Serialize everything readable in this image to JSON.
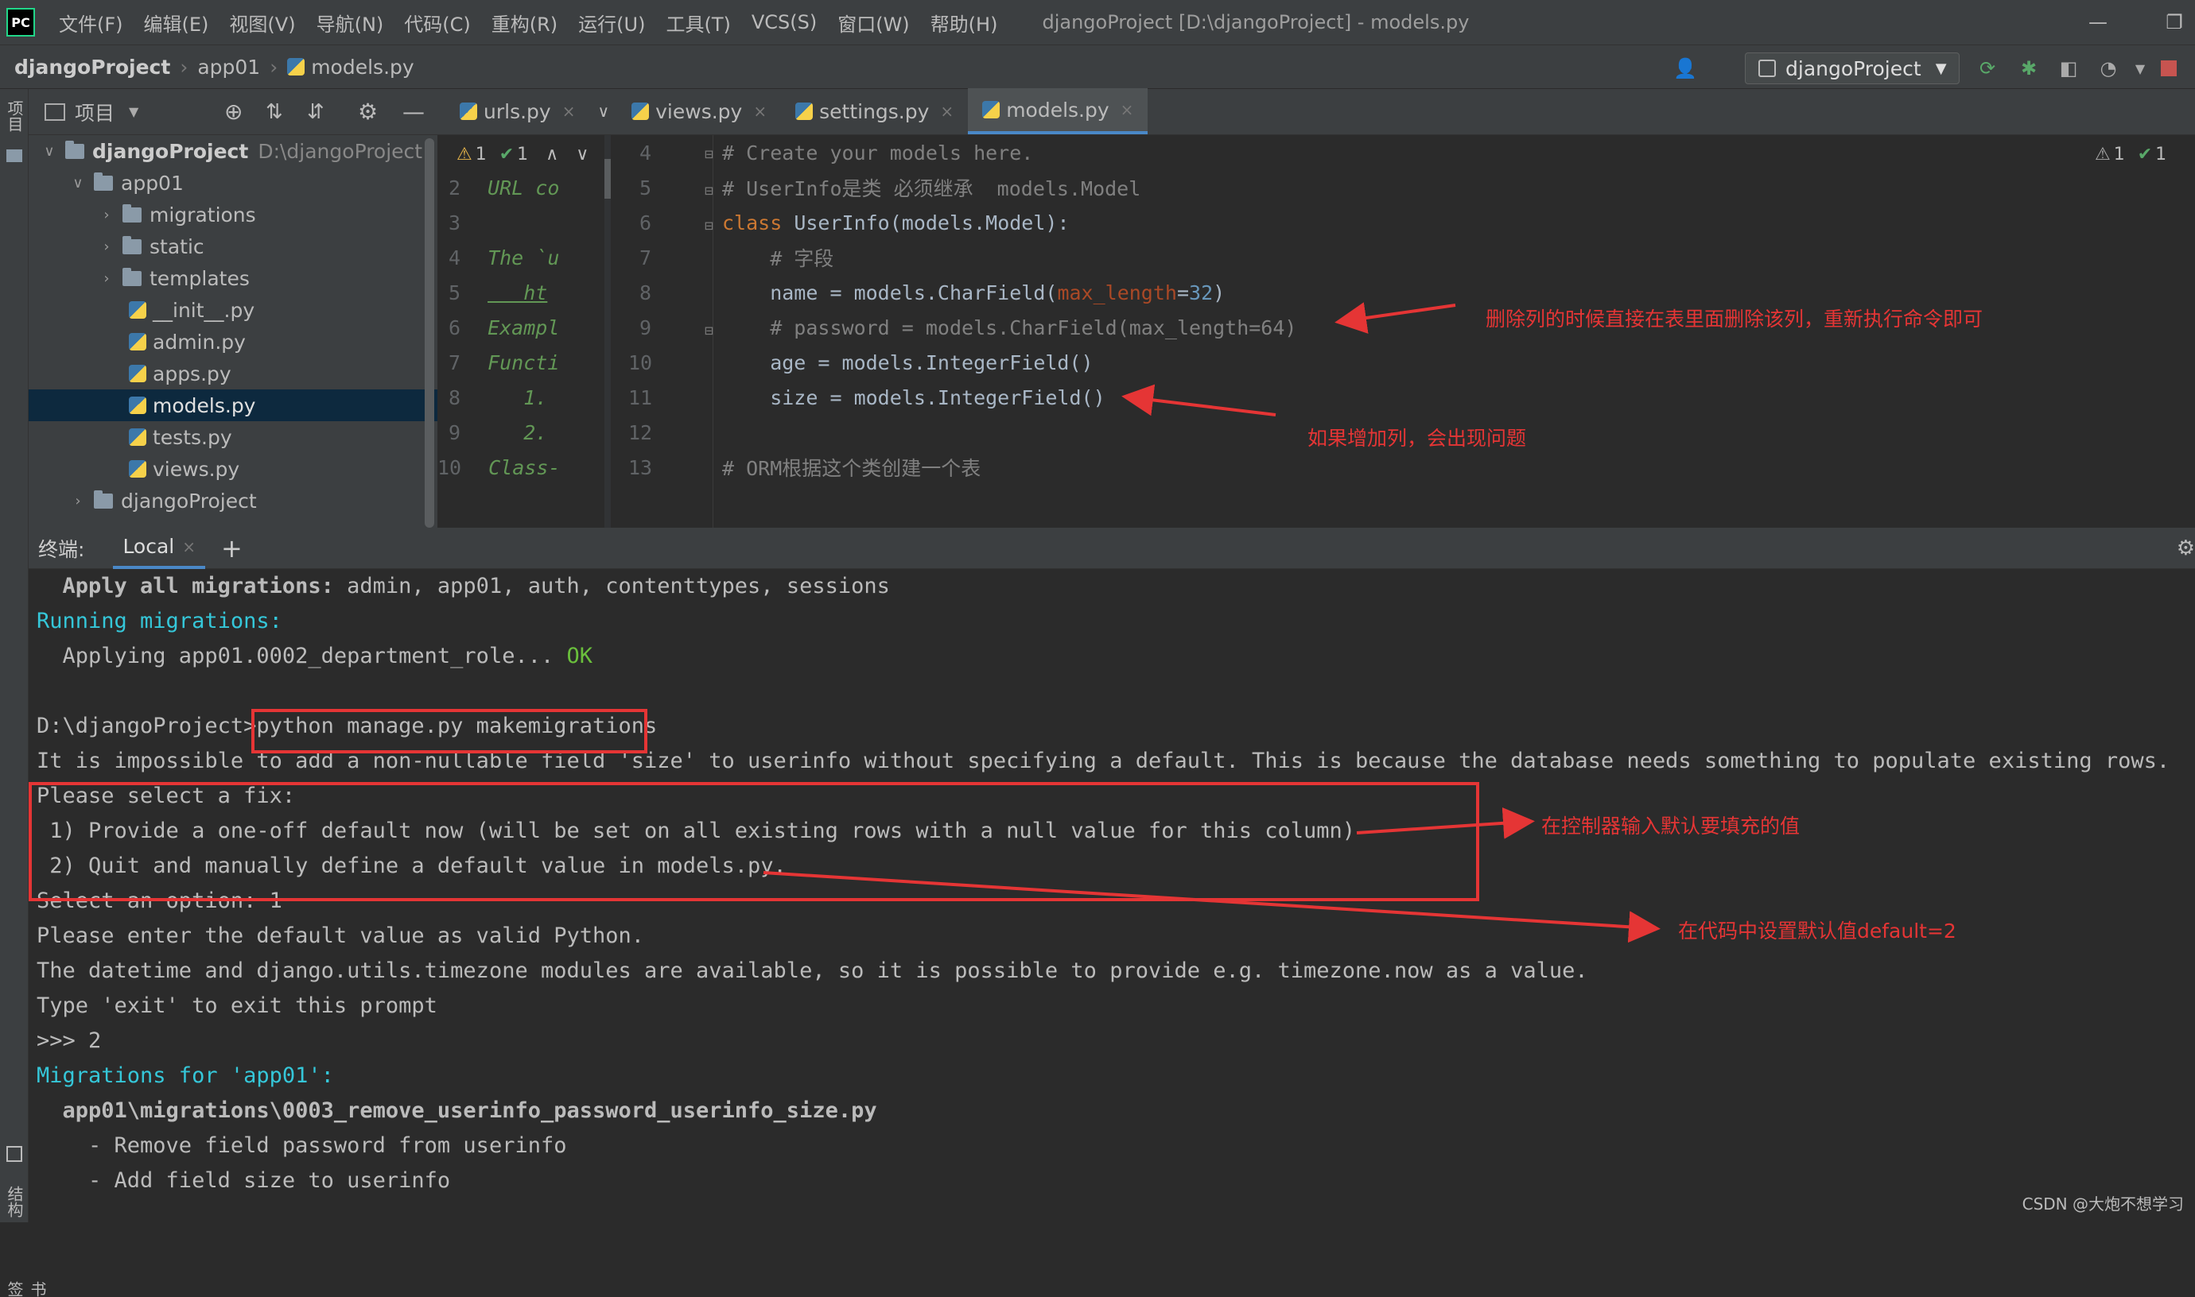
{
  "app": {
    "logo": "PC",
    "menu": [
      "文件(F)",
      "编辑(E)",
      "视图(V)",
      "导航(N)",
      "代码(C)",
      "重构(R)",
      "运行(U)",
      "工具(T)",
      "VCS(S)",
      "窗口(W)",
      "帮助(H)"
    ],
    "window_title": "djangoProject [D:\\djangoProject] - models.py",
    "minimize": "—",
    "restore": "❐"
  },
  "navbar": {
    "breadcrumb": [
      "djangoProject",
      "app01",
      "models.py"
    ],
    "run_config": "djangoProject"
  },
  "left_strip": {
    "project_label": "项目",
    "structure_label": "结构",
    "bookmarks_label": "书签"
  },
  "project_panel": {
    "title": "项目",
    "tree": [
      {
        "label": "djangoProject",
        "path": "D:\\djangoProject",
        "indent": 0,
        "kind": "folder",
        "open": true
      },
      {
        "label": "app01",
        "indent": 1,
        "kind": "folder",
        "open": true
      },
      {
        "label": "migrations",
        "indent": 2,
        "kind": "folder",
        "open": false
      },
      {
        "label": "static",
        "indent": 2,
        "kind": "folder",
        "open": false
      },
      {
        "label": "templates",
        "indent": 2,
        "kind": "folder",
        "open": false
      },
      {
        "label": "__init__.py",
        "indent": 3,
        "kind": "py"
      },
      {
        "label": "admin.py",
        "indent": 3,
        "kind": "py"
      },
      {
        "label": "apps.py",
        "indent": 3,
        "kind": "py"
      },
      {
        "label": "models.py",
        "indent": 3,
        "kind": "py",
        "selected": true
      },
      {
        "label": "tests.py",
        "indent": 3,
        "kind": "py"
      },
      {
        "label": "views.py",
        "indent": 3,
        "kind": "py"
      },
      {
        "label": "djangoProject",
        "indent": 1,
        "kind": "folder",
        "open": false
      }
    ]
  },
  "editor": {
    "tabs": [
      {
        "label": "urls.py",
        "active": false
      },
      {
        "label": "views.py",
        "active": false
      },
      {
        "label": "settings.py",
        "active": false
      },
      {
        "label": "models.py",
        "active": true
      }
    ],
    "inspection_left": {
      "warnings": "1",
      "checks": "1"
    },
    "inspection_right": {
      "warnings": "1",
      "checks": "1"
    },
    "left_pane_lines": [
      {
        "num": "",
        "text": ""
      },
      {
        "num": "2",
        "text": "URL co"
      },
      {
        "num": "3",
        "text": ""
      },
      {
        "num": "4",
        "text": "The `u"
      },
      {
        "num": "5",
        "text": "   ht"
      },
      {
        "num": "6",
        "text": "Exampl"
      },
      {
        "num": "7",
        "text": "Functi"
      },
      {
        "num": "8",
        "text": "   1."
      },
      {
        "num": "9",
        "text": "   2."
      },
      {
        "num": "10",
        "text": "Class-"
      }
    ],
    "right_pane_nums": [
      "4",
      "5",
      "6",
      "7",
      "8",
      "9",
      "10",
      "11",
      "12",
      "13"
    ],
    "code": {
      "l4": "# Create your models here.",
      "l5": "# UserInfo是类 必须继承  models.Model",
      "l6_kw": "class",
      "l6_rest": " UserInfo(models.Model):",
      "l7": "    # 字段",
      "l8_a": "    name = models.CharField(",
      "l8_param": "max_length",
      "l8_eq": "=",
      "l8_num": "32",
      "l8_end": ")",
      "l9": "    # password = models.CharField(max_length=64)",
      "l10": "    age = models.IntegerField()",
      "l11": "    size = models.IntegerField()",
      "l12": "",
      "l13": "# ORM根据这个类创建一个表"
    }
  },
  "terminal": {
    "label": "终端:",
    "tab": "Local",
    "tab_close": "×",
    "add": "+",
    "lines": {
      "apply_bold": "  Apply all migrations:",
      "apply_rest": " admin, app01, auth, contenttypes, sessions",
      "running": "Running migrations:",
      "applying": "  Applying app01.0002_department_role...",
      "ok": " OK",
      "blank": "",
      "prompt": "D:\\djangoProject>",
      "cmd": "python manage.py makemigrations",
      "impossible": "It is impossible to add a non-nullable field 'size' to userinfo without specifying a default. This is because the database needs something to populate existing rows.",
      "select_fix": "Please select a fix:",
      "opt1": " 1) Provide a one-off default now (will be set on all existing rows with a null value for this column)",
      "opt2": " 2) Quit and manually define a default value in models.py.",
      "select_option": "Select an option: 1",
      "enter_default": "Please enter the default value as valid Python.",
      "datetime": "The datetime and django.utils.timezone modules are available, so it is possible to provide e.g. timezone.now as a value.",
      "type_exit": "Type 'exit' to exit this prompt",
      "answer": ">>> 2",
      "migrations_for": "Migrations for 'app01':",
      "migration_file": "  app01\\migrations\\0003_remove_userinfo_password_userinfo_size.py",
      "remove_field": "    - Remove field password from userinfo",
      "add_field": "    - Add field size to userinfo"
    }
  },
  "annotations": {
    "delete_column": "删除列的时候直接在表里面删除该列，重新执行命令即可",
    "add_column": "如果增加列，会出现问题",
    "option1_note": "在控制器输入默认要填充的值",
    "option2_note": "在代码中设置默认值default=2"
  },
  "watermark": "CSDN @大炮不想学习"
}
